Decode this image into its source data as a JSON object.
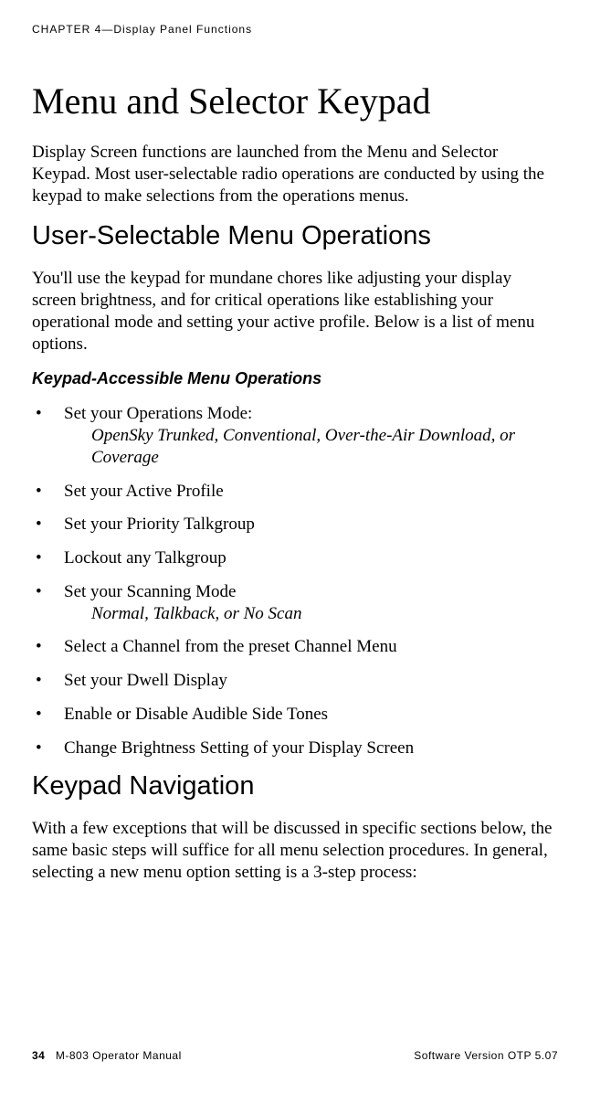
{
  "chapter_header": "CHAPTER 4—Display Panel Functions",
  "main_title": "Menu and Selector Keypad",
  "intro_text": "Display Screen functions are launched from the Menu and Selector Keypad. Most user-selectable radio operations are conducted by using the keypad to make selections from the operations menus.",
  "section1_title": "User-Selectable Menu Operations",
  "section1_text": "You'll use the keypad for mundane chores like adjusting your display screen brightness, and for critical operations like establishing your operational mode and setting your active profile. Below is a list of menu options.",
  "sub_italic": "Keypad-Accessible Menu Operations",
  "bullets": [
    {
      "text": "Set your Operations Mode:",
      "sub": "OpenSky Trunked, Conventional, Over-the-Air Download, or Coverage"
    },
    {
      "text": "Set your Active Profile"
    },
    {
      "text": "Set your Priority Talkgroup"
    },
    {
      "text": "Lockout any Talkgroup"
    },
    {
      "text": "Set your Scanning Mode",
      "sub": "Normal, Talkback, or No Scan"
    },
    {
      "text": "Select a Channel from the preset Channel Menu"
    },
    {
      "text": "Set your Dwell Display"
    },
    {
      "text": "Enable or Disable Audible Side Tones"
    },
    {
      "text": "Change Brightness Setting of your Display Screen"
    }
  ],
  "section2_title": "Keypad Navigation",
  "section2_text": "With a few exceptions that will be discussed in specific sections below, the same basic steps will suffice for all menu selection procedures. In general, selecting a new menu option setting is a 3-step process:",
  "footer": {
    "page_num": "34",
    "left_label": "M-803 Operator Manual",
    "right_label": "Software Version OTP 5.07"
  }
}
